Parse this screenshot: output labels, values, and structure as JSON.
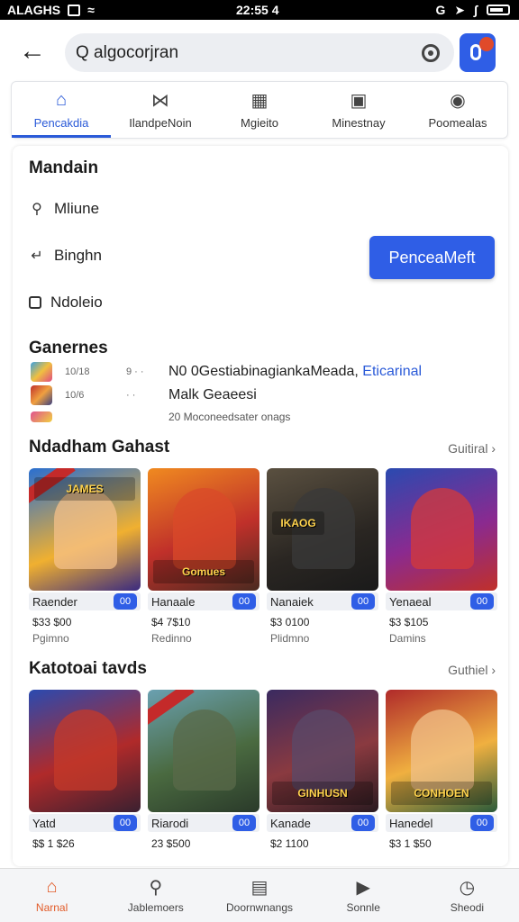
{
  "status": {
    "carrier": "ALAGHS",
    "time": "22:55 4"
  },
  "search": {
    "value": "Q algocorjran"
  },
  "tabs": [
    {
      "label": "Pencakdia",
      "icon": "home-icon"
    },
    {
      "label": "IlandpeNoin",
      "icon": "bowtie-icon"
    },
    {
      "label": "Mgieito",
      "icon": "grid-icon"
    },
    {
      "label": "Minestnay",
      "icon": "tv-icon"
    },
    {
      "label": "Poomealas",
      "icon": "camera-icon"
    }
  ],
  "filters": {
    "title": "Mandain",
    "items": [
      {
        "label": "Mliune",
        "icon": "search-icon"
      },
      {
        "label": "Binghn",
        "icon": "arrow-icon"
      },
      {
        "label": "Ndoleio",
        "icon": "checkbox-icon"
      }
    ],
    "button": "PenceaMeft"
  },
  "genres": {
    "title": "Ganernes",
    "rows": [
      {
        "count": "10/18",
        "dots": "9 · ·",
        "text": "N0 0Gestiabinagiank",
        "text2": "aMeada, ",
        "link": "Eticarinal"
      },
      {
        "count": "10/6",
        "dots": "· ·",
        "text": "Malk Geaeesi"
      },
      {
        "count": "",
        "dots": "",
        "text": "20 Moconeedsater onags"
      }
    ]
  },
  "section1": {
    "title": "Ndadham Gahast",
    "see_all": "Guitiral",
    "cards": [
      {
        "banner": "JAMES",
        "name": "Raender",
        "badge": "00",
        "price": "$33 $00",
        "meta": "Pgimno"
      },
      {
        "banner": "Gomues",
        "name": "Hanaale",
        "badge": "00",
        "price": "$4 7$10",
        "meta": "Redinno"
      },
      {
        "banner": "IKAOG",
        "name": "Nanaiek",
        "badge": "00",
        "price": "$3 0100",
        "meta": "Plidmno"
      },
      {
        "banner": "",
        "name": "Yenaeal",
        "badge": "00",
        "price": "$3 $105",
        "meta": "Damins"
      }
    ]
  },
  "section2": {
    "title": "Katotoai tavds",
    "see_all": "Guthiel",
    "cards": [
      {
        "banner": "",
        "name": "Yatd",
        "badge": "00",
        "price": "$$ 1 $26",
        "meta": ""
      },
      {
        "banner": "",
        "name": "Riarodi",
        "badge": "00",
        "price": "23 $500",
        "meta": ""
      },
      {
        "banner": "GINHUSN",
        "name": "Kanade",
        "badge": "00",
        "price": "$2 1100",
        "meta": ""
      },
      {
        "banner": "CONHOEN",
        "name": "Hanedel",
        "badge": "00",
        "price": "$3 1 $50",
        "meta": ""
      }
    ]
  },
  "bottom_nav": [
    {
      "label": "Narnal",
      "icon": "home-icon"
    },
    {
      "label": "Jablemoers",
      "icon": "search-icon"
    },
    {
      "label": "Doornwnangs",
      "icon": "download-icon"
    },
    {
      "label": "Sonnle",
      "icon": "play-icon"
    },
    {
      "label": "Sheodi",
      "icon": "clock-icon"
    }
  ],
  "colors": {
    "accent": "#2f5ee6",
    "nav_active": "#e25c2a"
  }
}
